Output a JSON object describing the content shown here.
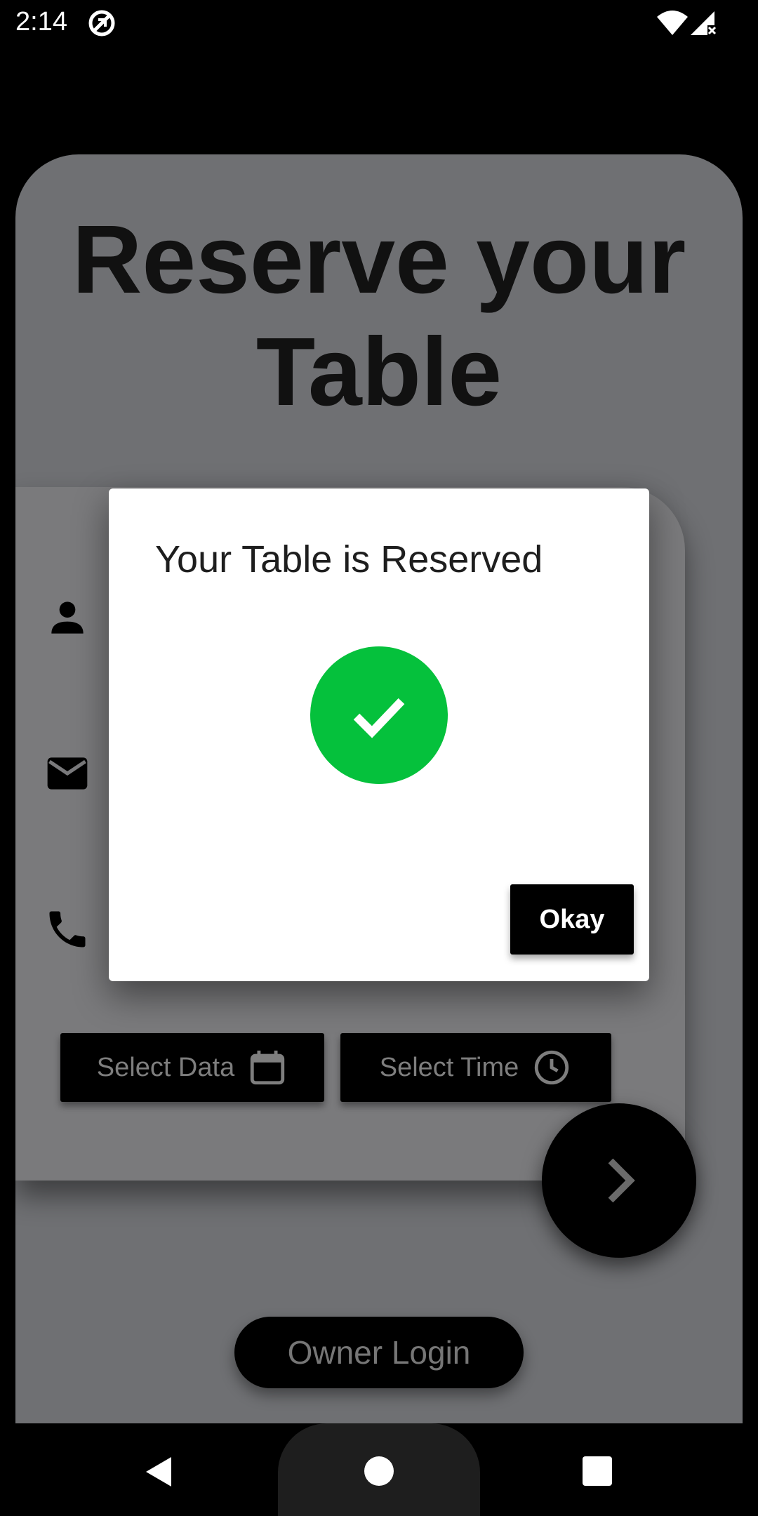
{
  "status_bar": {
    "time": "2:14"
  },
  "page": {
    "title": "Reserve your Table"
  },
  "form": {
    "select_date_label": "Select Data",
    "select_time_label": "Select Time"
  },
  "owner_login_label": "Owner Login",
  "dialog": {
    "title": "Your Table is Reserved",
    "okay_label": "Okay"
  },
  "colors": {
    "success": "#05c13c",
    "background_overlay": "#6f7073",
    "button": "#000000"
  },
  "icons": {
    "name_field": "person-icon",
    "email_field": "mail-icon",
    "phone_field": "phone-icon",
    "date": "calendar-icon",
    "time": "clock-icon",
    "next": "chevron-right-icon",
    "success": "checkmark-icon"
  }
}
